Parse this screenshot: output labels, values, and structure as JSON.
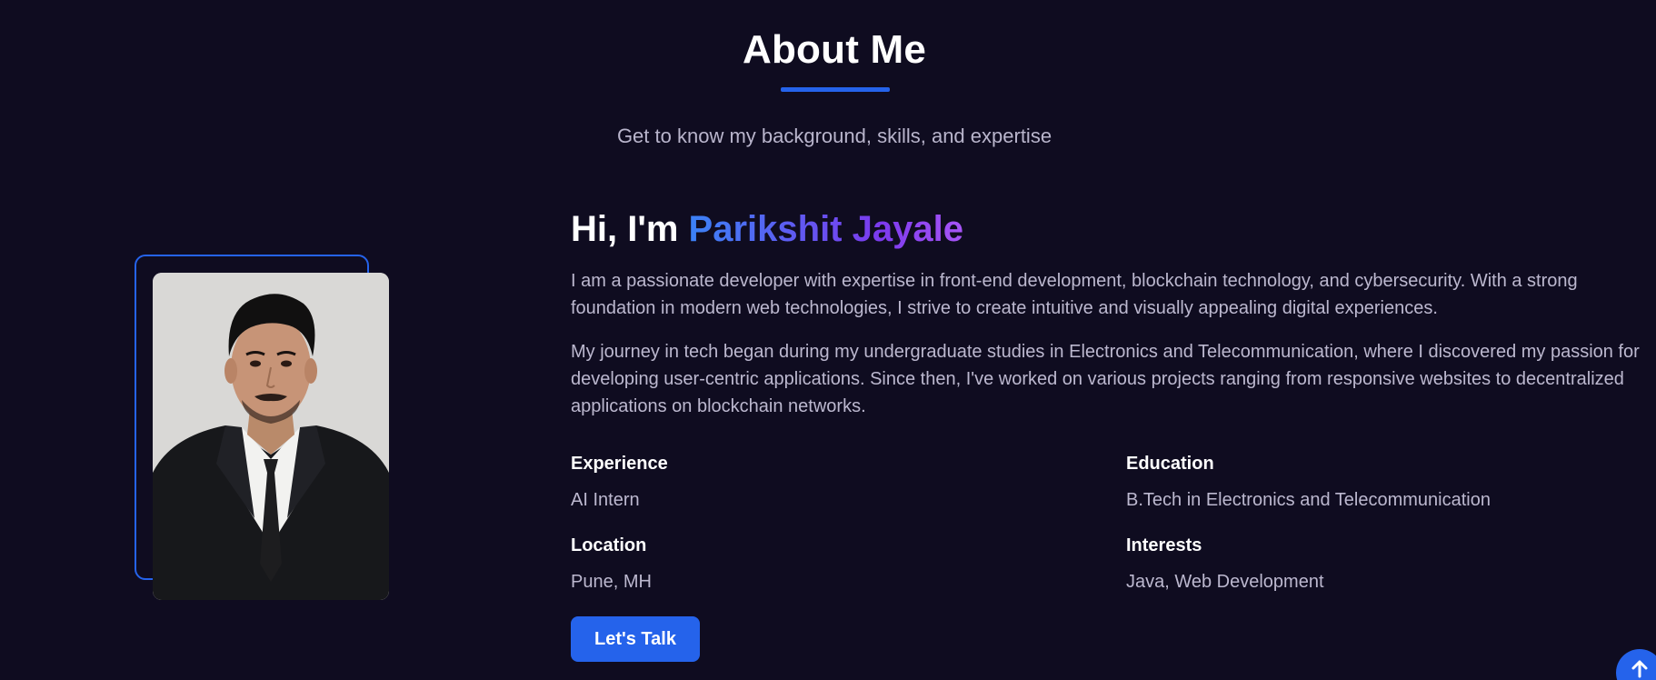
{
  "header": {
    "title": "About Me",
    "subtitle": "Get to know my background, skills, and expertise"
  },
  "intro": {
    "greeting_prefix": "Hi, I'm ",
    "name": "Parikshit Jayale",
    "paragraph_1": "I am a passionate developer with expertise in front-end development, blockchain technology, and cybersecurity. With a strong foundation in modern web technologies, I strive to create intuitive and visually appealing digital experiences.",
    "paragraph_2": "My journey in tech began during my undergraduate studies in Electronics and Telecommunication, where I discovered my passion for developing user-centric applications. Since then, I've worked on various projects ranging from responsive websites to decentralized applications on blockchain networks."
  },
  "info": [
    {
      "label": "Experience",
      "value": "AI Intern"
    },
    {
      "label": "Education",
      "value": "B.Tech in Electronics and Telecommunication"
    },
    {
      "label": "Location",
      "value": "Pune, MH"
    },
    {
      "label": "Interests",
      "value": "Java, Web Development"
    }
  ],
  "cta": {
    "label": "Let's Talk"
  },
  "icons": {
    "scroll_top": "arrow-up-icon"
  },
  "colors": {
    "background": "#0f0c20",
    "accent": "#2563eb",
    "gradient_start": "#3b82f6",
    "gradient_end": "#a855f7"
  }
}
